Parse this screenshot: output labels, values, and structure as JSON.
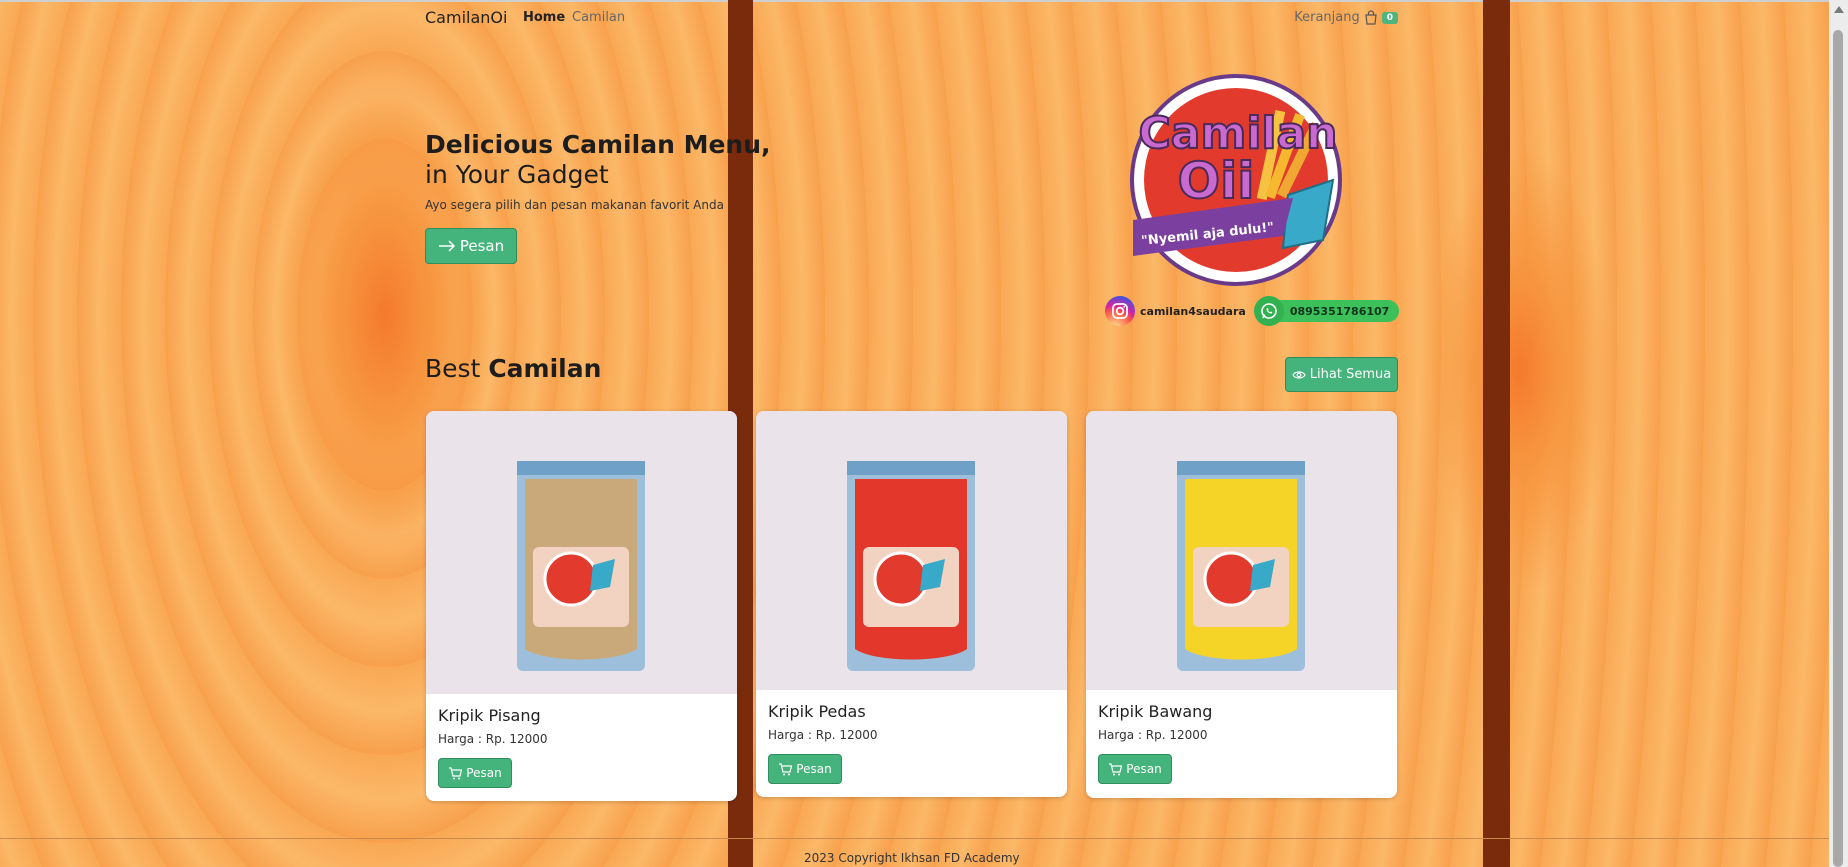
{
  "nav": {
    "brand": "CamilanOi",
    "home": "Home",
    "camilan": "Camilan",
    "cart_label": "Keranjang",
    "cart_count": "0"
  },
  "hero": {
    "title": "Delicious Camilan Menu,",
    "subtitle": "in Your Gadget",
    "description": "Ayo segera pilih dan pesan makanan favorit Anda",
    "button_label": "Pesan"
  },
  "logo": {
    "line1": "Camilan",
    "line2": "Oii",
    "tagline": "\"Nyemil aja dulu!\""
  },
  "social": {
    "instagram": "camilan4saudara",
    "whatsapp": "0895351786107"
  },
  "section": {
    "title_light": "Best",
    "title_bold": "Camilan",
    "see_all": "Lihat Semua"
  },
  "products": [
    {
      "name": "Kripik Pisang",
      "price": "Harga : Rp. 12000",
      "button": "Pesan",
      "color": "#c9a97a"
    },
    {
      "name": "Kripik Pedas",
      "price": "Harga : Rp. 12000",
      "button": "Pesan",
      "color": "#e2372a"
    },
    {
      "name": "Kripik Bawang",
      "price": "Harga : Rp. 12000",
      "button": "Pesan",
      "color": "#f5d327"
    }
  ],
  "footer": {
    "text": "2023 Copyright Ikhsan FD Academy"
  },
  "colors": {
    "accent": "#45b37c",
    "bar": "#7a2b0c",
    "background": "#f9b062"
  }
}
